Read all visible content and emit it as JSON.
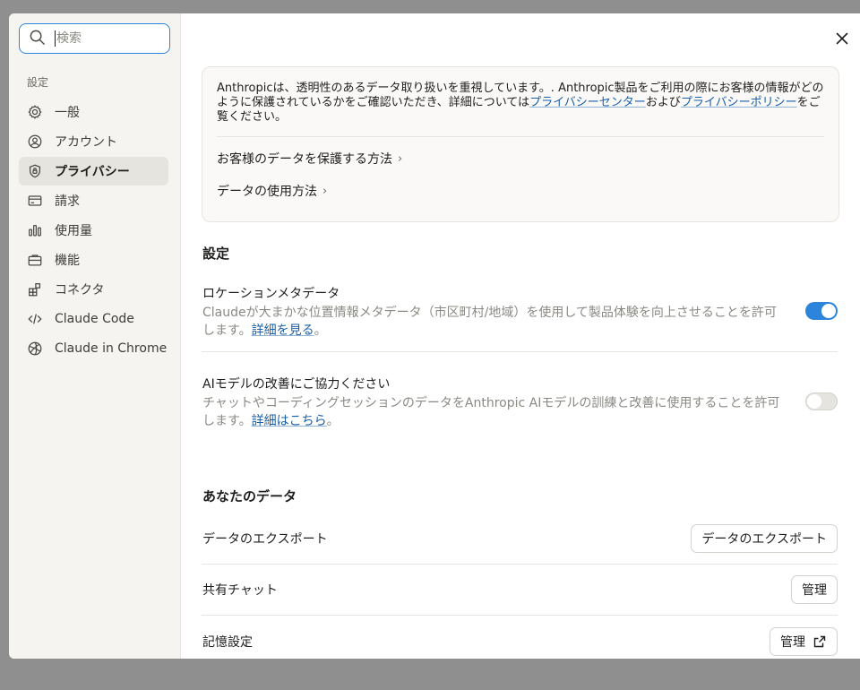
{
  "search": {
    "placeholder": "検索"
  },
  "sidebar": {
    "section_label": "設定",
    "items": [
      {
        "label": "一般",
        "icon": "gear-icon"
      },
      {
        "label": "アカウント",
        "icon": "user-circle-icon"
      },
      {
        "label": "プライバシー",
        "icon": "shield-icon",
        "active": true
      },
      {
        "label": "請求",
        "icon": "credit-card-icon"
      },
      {
        "label": "使用量",
        "icon": "bar-chart-icon"
      },
      {
        "label": "機能",
        "icon": "briefcase-icon"
      },
      {
        "label": "コネクタ",
        "icon": "blocks-icon"
      },
      {
        "label": "Claude Code",
        "icon": "code-icon"
      },
      {
        "label": "Claude in Chrome",
        "icon": "globe-icon"
      }
    ]
  },
  "privacy_card": {
    "text_pre": "Anthropicは、透明性のあるデータ取り扱いを重視しています。. Anthropic製品をご利用の際にお客様の情報がどのように保護されているかをご確認いただき、詳細については",
    "privacy_center_link": "プライバシーセンター",
    "text_mid": "および",
    "privacy_policy_link": "プライバシーポリシー",
    "text_post": "をご覧ください。",
    "links": [
      {
        "label": "お客様のデータを保護する方法"
      },
      {
        "label": "データの使用方法"
      }
    ]
  },
  "settings": {
    "heading": "設定",
    "location": {
      "title": "ロケーションメタデータ",
      "desc": "Claudeが大まかな位置情報メタデータ（市区町村/地域）を使用して製品体験を向上させることを許可します。",
      "link": "詳細を見る",
      "tail": "。",
      "enabled": true
    },
    "ai_training": {
      "title": "AIモデルの改善にご協力ください",
      "desc": "チャットやコーディングセッションのデータをAnthropic AIモデルの訓練と改善に使用することを許可します。",
      "link": "詳細はこちら",
      "tail": "。",
      "enabled": false
    }
  },
  "your_data": {
    "heading": "あなたのデータ",
    "rows": [
      {
        "label": "データのエクスポート",
        "button": "データのエクスポート"
      },
      {
        "label": "共有チャット",
        "button": "管理"
      },
      {
        "label": "記憶設定",
        "button": "管理",
        "button_icon": "external-link-icon"
      }
    ]
  },
  "colors": {
    "accent": "#2c84db",
    "link": "#1a5fa8",
    "sidebar_bg": "#f5f4f0"
  }
}
